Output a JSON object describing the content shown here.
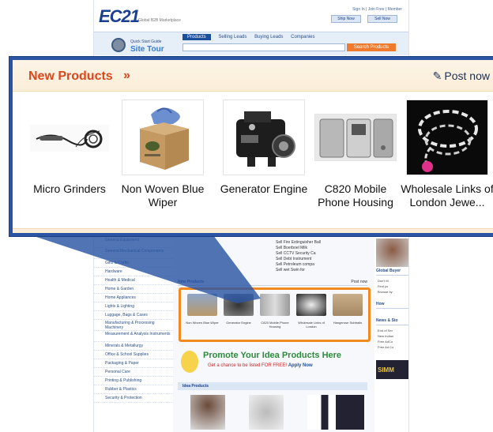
{
  "site": {
    "logo": "EC21",
    "logo_sub": "Global B2B Marketplace",
    "top_links": "Sign In | Join Free | Member",
    "ship_now": "Ship Now",
    "sell_now": "Sell Now",
    "tour_line1": "Quick Start Guide",
    "tour_line2": "Site Tour",
    "tabs": [
      "Products",
      "Selling Leads",
      "Buying Leads",
      "Companies"
    ],
    "search_button": "Search Products",
    "categories": [
      "General Equipment",
      "General Mechanical Components",
      "Gifts & Crafts",
      "Hardware",
      "Health & Medical",
      "Home & Garden",
      "Home Appliances",
      "Lights & Lighting",
      "Luggage, Bags & Cases",
      "Manufacturing & Processing Machinery",
      "Measurement & Analysis Instruments",
      "Minerals & Metallurgy",
      "Office & School Supplies",
      "Packaging & Paper",
      "Personal Care",
      "Printing & Publishing",
      "Rubber & Plastics",
      "Security & Protection"
    ],
    "news_rows": [
      "Sell Fire Extinguisher Ball",
      "Sell Boerboel Milk",
      "Sell CCTV Security Ca",
      "Sell Debt Instrument",
      "Sell Petroleum compa",
      "Sell wet Swin for"
    ],
    "new_products_small": "New Products",
    "post_now_small": "Post now",
    "mini_products": [
      "Non Woven Blue Wiper",
      "Generator Engine",
      "C820 Mobile Phone Housing",
      "Wholesale Links of London",
      "Hangerose Subtraits"
    ],
    "banner_title": "Promote Your Idea Products Here",
    "banner_sub": "Get a chance to be listed FOR FREE!",
    "banner_apply": "Apply Now",
    "ideas_bar": "Idea Products",
    "right_boxes": [
      "Global Buyer",
      "How",
      "News & Sto"
    ],
    "right_texts": [
      "Don't M",
      "Find yo",
      "Browse by",
      "End of Ser",
      "New Indian",
      "Free AdCo",
      "Free Ad Co"
    ],
    "right_banner": "SIMM"
  },
  "panel": {
    "title": "New Products",
    "raquo": "»",
    "post_now": "Post now",
    "products": [
      {
        "name": "Micro Grinders",
        "icon": "micro-grinder-image"
      },
      {
        "name": "Non Woven Blue Wiper",
        "icon": "wiper-box-image"
      },
      {
        "name": "Generator Engine",
        "icon": "engine-image"
      },
      {
        "name": "C820 Mobile Phone Housing",
        "icon": "phone-housing-image"
      },
      {
        "name": "Wholesale Links of London Jewe...",
        "icon": "jewelry-chain-image"
      }
    ]
  },
  "colors": {
    "accent": "#d9481f",
    "panel_border": "#2b55a4",
    "highlight": "#f28a22"
  }
}
